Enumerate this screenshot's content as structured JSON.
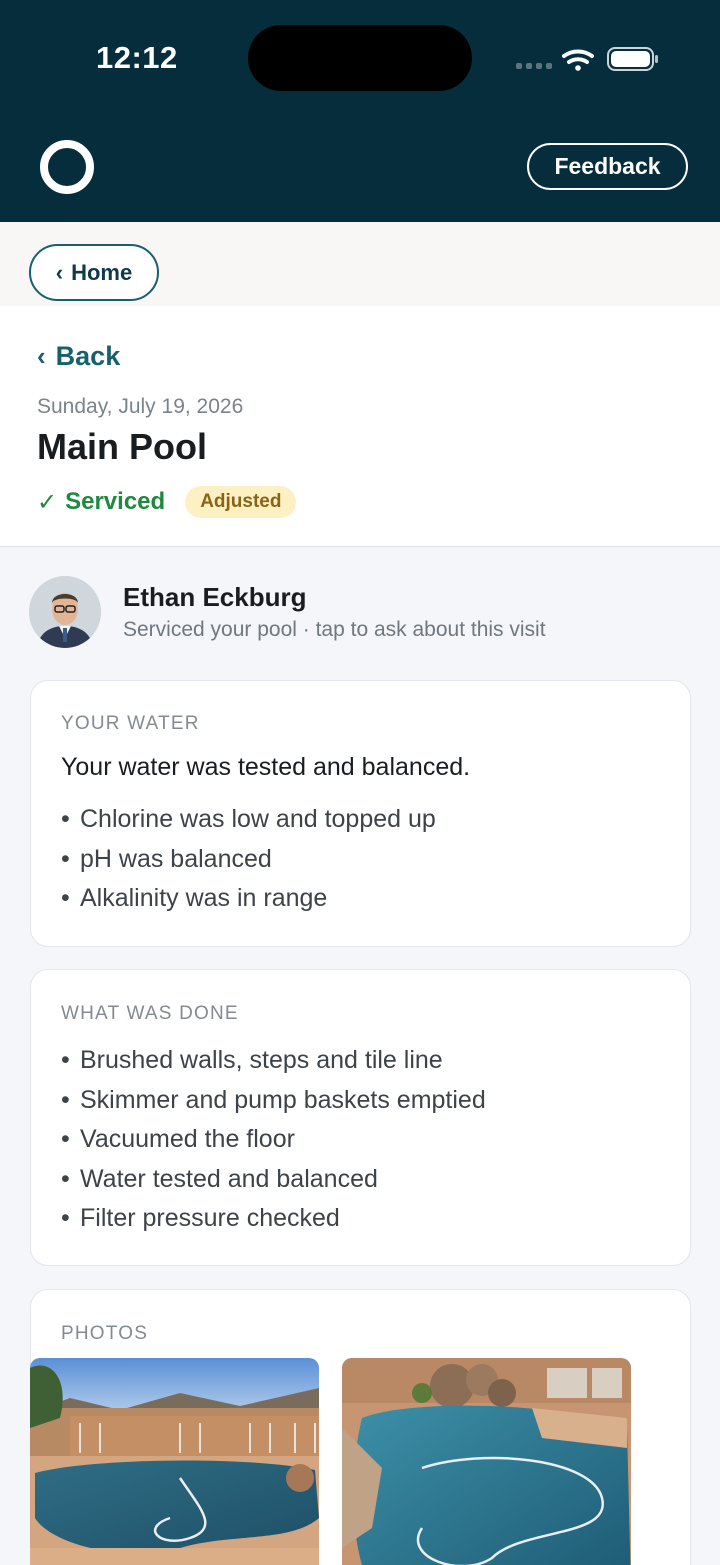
{
  "status_bar": {
    "time": "12:12"
  },
  "header": {
    "feedback_label": "Feedback"
  },
  "breadcrumb": {
    "home_label": "Home"
  },
  "visit": {
    "back_label": "Back",
    "date": "Sunday, July 19, 2026",
    "title": "Main Pool",
    "status": "Serviced",
    "badge": "Adjusted"
  },
  "technician": {
    "name": "Ethan Eckburg",
    "subtitle": "Serviced your pool · tap to ask about this visit"
  },
  "water": {
    "label": "YOUR WATER",
    "summary": "Your water was tested and balanced.",
    "items": [
      "Chlorine was low and topped up",
      "pH was balanced",
      "Alkalinity was in range"
    ]
  },
  "work": {
    "label": "WHAT WAS DONE",
    "items": [
      "Brushed walls, steps and tile line",
      "Skimmer and pump baskets emptied",
      "Vacuumed the floor",
      "Water tested and balanced",
      "Filter pressure checked"
    ]
  },
  "photos": {
    "label": "PHOTOS"
  },
  "colors": {
    "header_bg": "#062d3c",
    "accent": "#17606e",
    "success": "#1f8a3f",
    "badge_bg": "#fdf1c4",
    "badge_text": "#8a6414"
  },
  "icons": [
    "wifi-icon",
    "battery-icon",
    "brand-ring-icon",
    "chevron-left-icon",
    "checkmark-icon"
  ]
}
